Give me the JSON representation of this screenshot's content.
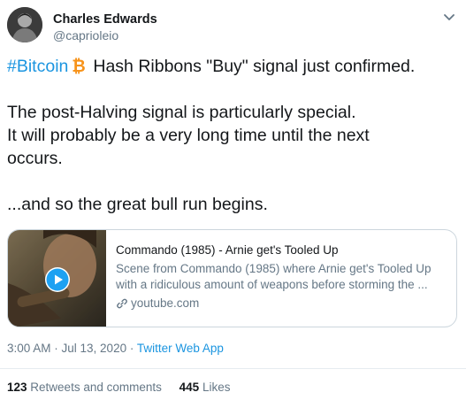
{
  "user": {
    "name": "Charles Edwards",
    "handle": "@caprioleio"
  },
  "tweet": {
    "hashtag": "#Bitcoin",
    "line1": "Hash Ribbons \"Buy\" signal just confirmed.",
    "line2": "The post-Halving signal is particularly special.",
    "line3": "It will probably be a very long time until the next",
    "line4": "occurs.",
    "line5": "...and so the great bull run begins."
  },
  "card": {
    "title": "Commando (1985) - Arnie get's Tooled Up",
    "desc1": "Scene from Commando (1985) where Arnie get's Tooled Up",
    "desc2": "with a ridiculous amount of weapons before storming the ...",
    "domain": "youtube.com"
  },
  "meta": {
    "time": "3:00 AM · Jul 13, 2020 · ",
    "app": "Twitter Web App"
  },
  "stats": {
    "retweets_count": "123",
    "retweets_label": "Retweets and comments",
    "likes_count": "445",
    "likes_label": "Likes"
  },
  "colors": {
    "link": "#1b95e0",
    "bitcoin": "#f7931a",
    "secondary_text": "#657786"
  },
  "icons": {
    "bitcoin": "bitcoin-icon",
    "more": "chevron-down-icon",
    "play": "play-icon",
    "link": "link-icon"
  }
}
